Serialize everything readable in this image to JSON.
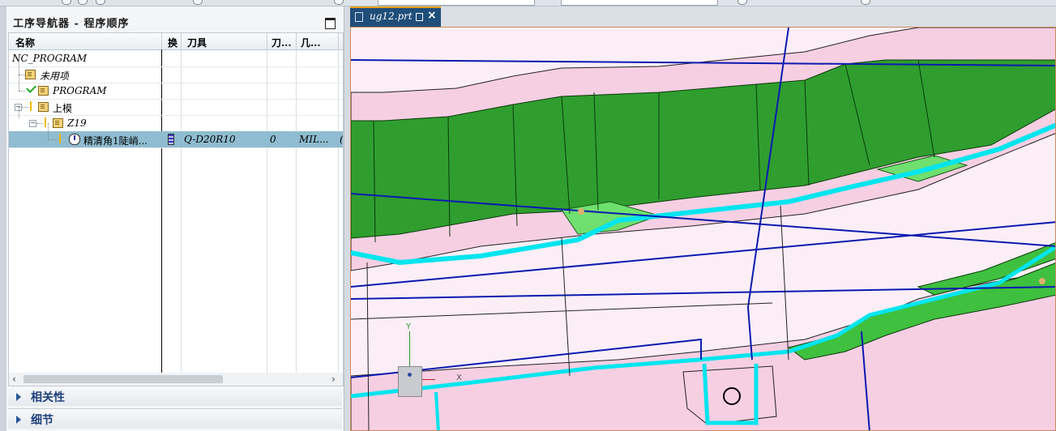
{
  "navigator": {
    "title": "工序导航器 - 程序顺序",
    "columns": [
      "名称",
      "换",
      "刀具",
      "刀...",
      "几...",
      ""
    ],
    "rows": [
      {
        "name": "NC_PROGRAM",
        "tool": "",
        "col3": "",
        "col4": ""
      },
      {
        "name": "未用项",
        "tool": "",
        "col3": "",
        "col4": ""
      },
      {
        "name": "PROGRAM",
        "tool": "",
        "col3": "",
        "col4": ""
      },
      {
        "name": "上模",
        "tool": "",
        "col3": "",
        "col4": ""
      },
      {
        "name": "Z19",
        "tool": "",
        "col3": "",
        "col4": ""
      },
      {
        "name": "精清角1陡峭...",
        "tool": "Q-D20R10",
        "col3": "0",
        "col4": "MIL...",
        "col5": "("
      }
    ],
    "sections": [
      {
        "label": "相关性"
      },
      {
        "label": "细节"
      }
    ],
    "scroll_left": "‹",
    "scroll_right": "›"
  },
  "viewport": {
    "tab_label": "ug12.prt",
    "close_symbol": "×",
    "triad": {
      "x_label": "X",
      "y_label": "Y"
    }
  },
  "colors": {
    "tab_bg": "#1f4e79",
    "selection": "#8fbcd0",
    "model_green": "#2f9e2f",
    "toolpath_cyan": "#00e5ee",
    "axis_blue": "#0a1ab0",
    "canvas_bg": "#fbeef6"
  }
}
